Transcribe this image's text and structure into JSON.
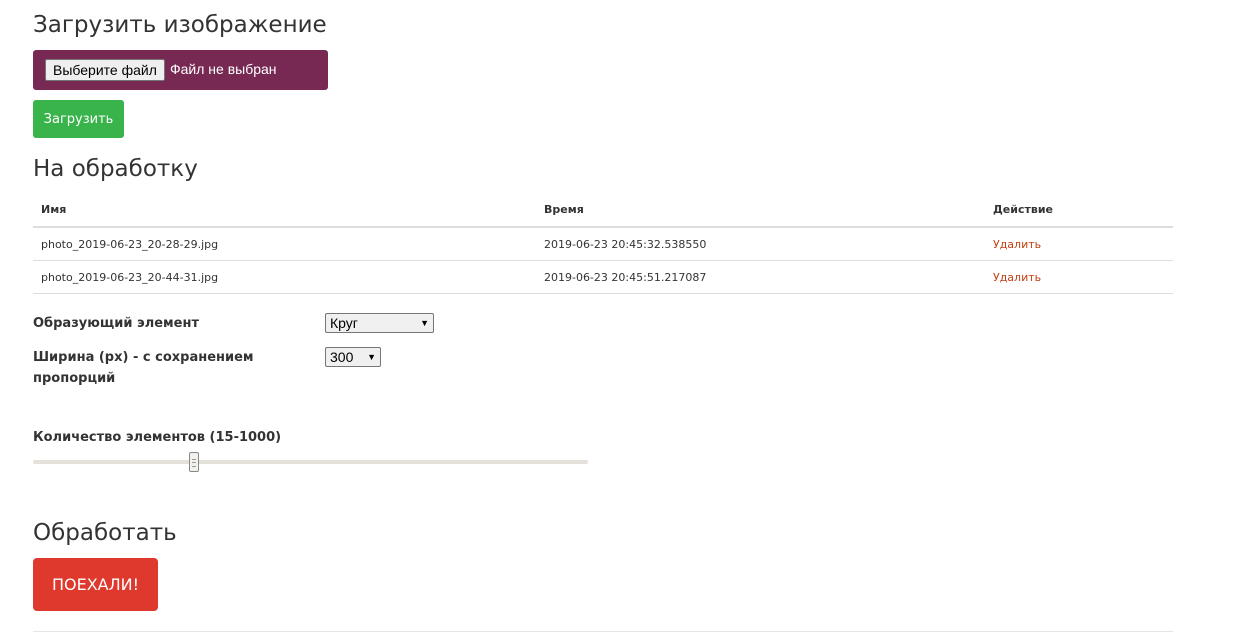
{
  "upload": {
    "title": "Загрузить изображение",
    "choose_file_label": "Выберите файл",
    "no_file_text": "Файл не выбран",
    "upload_button": "Загрузить"
  },
  "queue": {
    "title": "На обработку",
    "columns": [
      "Имя",
      "Время",
      "Действие"
    ],
    "rows": [
      {
        "name": "photo_2019-06-23_20-28-29.jpg",
        "time": "2019-06-23 20:45:32.538550",
        "action": "Удалить"
      },
      {
        "name": "photo_2019-06-23_20-44-31.jpg",
        "time": "2019-06-23 20:45:51.217087",
        "action": "Удалить"
      }
    ]
  },
  "settings": {
    "shape_label": "Образующий элемент",
    "shape_value": "Круг",
    "width_label": "Ширина (px) - с сохранением пропорций",
    "width_value": "300",
    "count_label": "Количество элементов (15-1000)",
    "count_slider_fraction": 0.29
  },
  "process": {
    "title": "Обработать",
    "go_button": "ПОЕХАЛИ!"
  },
  "colors": {
    "file_box": "#772953",
    "upload_button": "#38b44a",
    "go_button": "#df382c",
    "delete_link": "#c34113"
  },
  "icons": {
    "select_arrow": "dropdown-triangle",
    "slider_grip": "grip-lines"
  }
}
